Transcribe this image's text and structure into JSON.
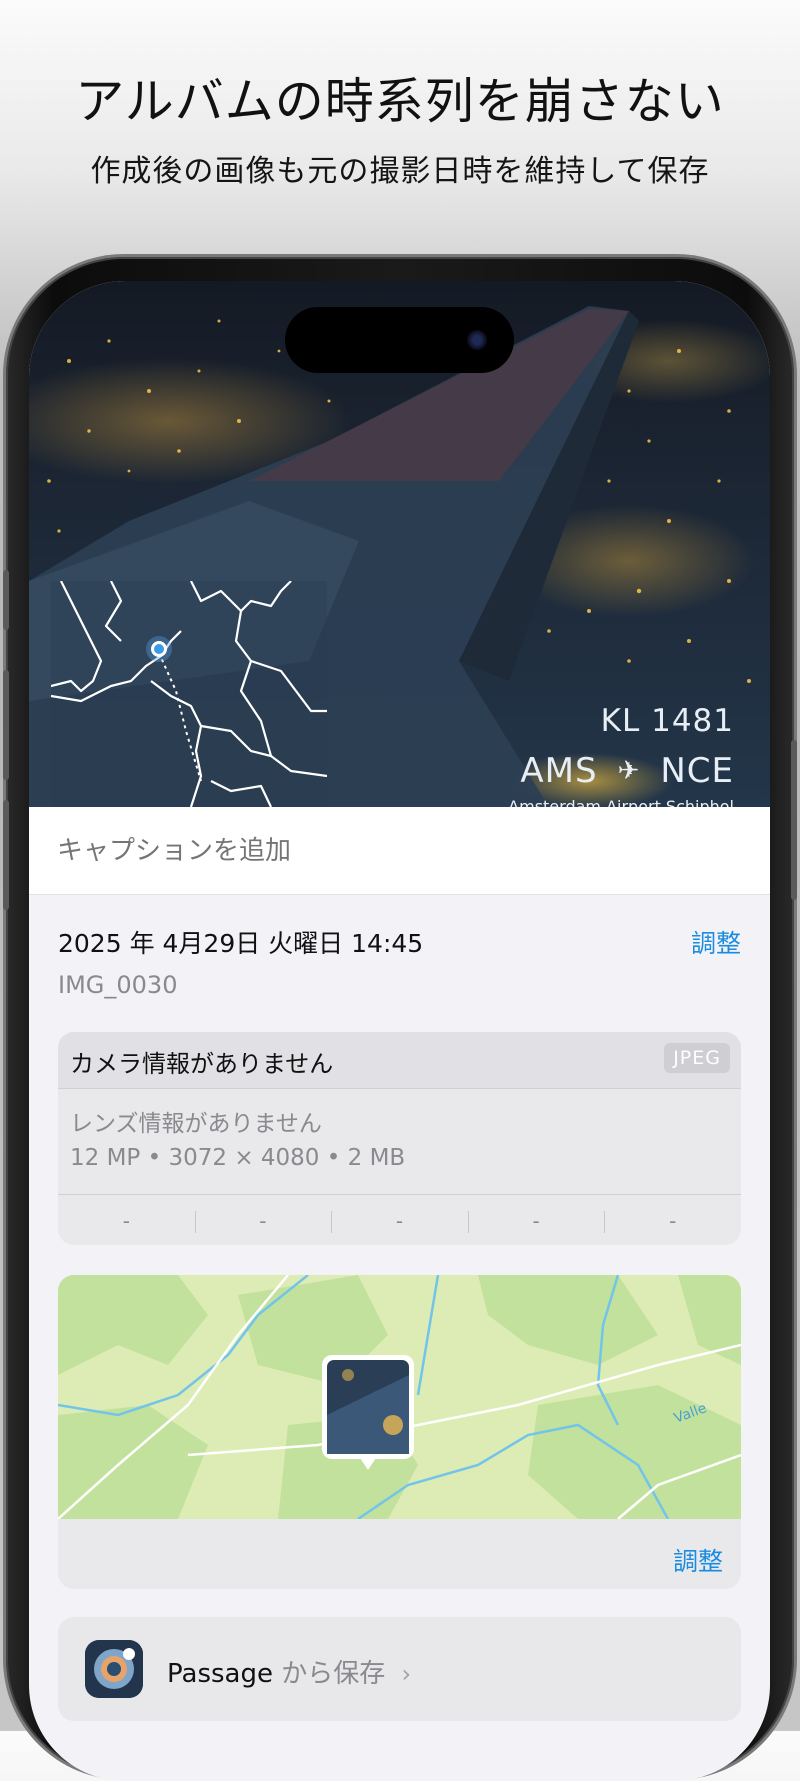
{
  "headline": "アルバムの時系列を崩さない",
  "subheadline": "作成後の画像も元の撮影日時を維持して保存",
  "photo": {
    "flight_code": "KL 1481",
    "origin": "AMS",
    "destination": "NCE",
    "plane_glyph": "✈",
    "airport_name": "Amsterdam Airport Schiphol"
  },
  "caption": {
    "placeholder": "キャプションを追加"
  },
  "info": {
    "datetime": "2025 年 4月29日 火曜日 14:45",
    "adjust_label": "調整",
    "filename": "IMG_0030"
  },
  "camera": {
    "title": "カメラ情報がありません",
    "format": "JPEG",
    "lens": "レンズ情報がありません",
    "specs": "12 MP • 3072 × 4080 • 2 MB",
    "exif_values": [
      "-",
      "-",
      "-",
      "-",
      "-"
    ]
  },
  "map": {
    "adjust_label": "調整",
    "place_label": "Valle"
  },
  "save": {
    "app_name": "Passage",
    "from_label": "から保存",
    "chevron": "›"
  },
  "colors": {
    "accent": "#1a8ce0",
    "map_land": "#c9e4a6",
    "map_water": "#6fc0e8"
  }
}
